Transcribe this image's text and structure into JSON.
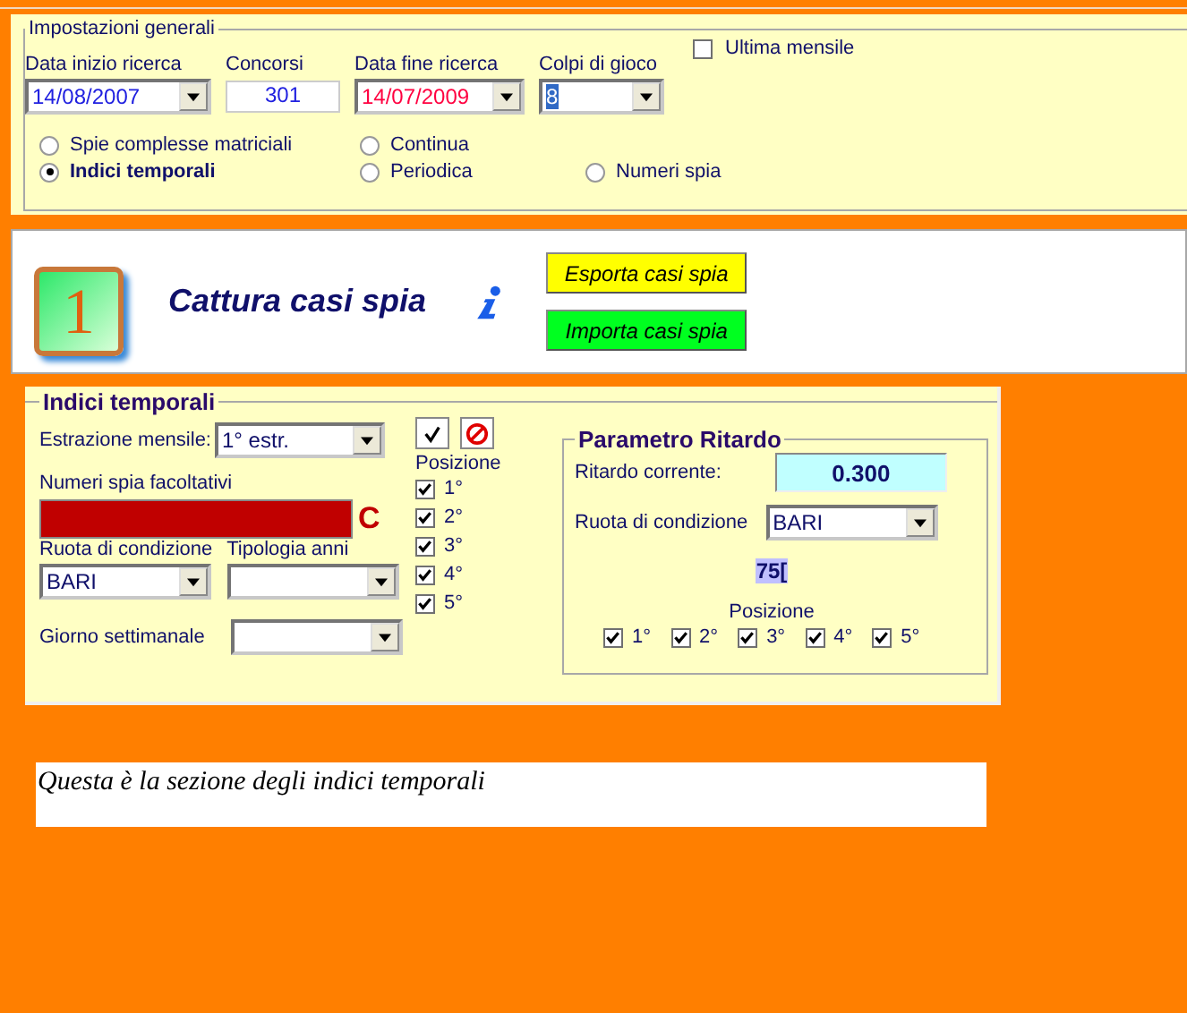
{
  "general": {
    "title": "Impostazioni generali",
    "fields": [
      {
        "label": "Data inizio ricerca",
        "value": "14/08/2007",
        "kind": "combo",
        "color": "#2020e0",
        "text_selected": false
      },
      {
        "label": "Concorsi",
        "value": "301",
        "kind": "text",
        "color": "#2020e0",
        "text_selected": false
      },
      {
        "label": "Data fine ricerca",
        "value": "14/07/2009",
        "kind": "combo",
        "color": "#ff0040",
        "text_selected": false
      },
      {
        "label": "Colpi di gioco",
        "value": "8",
        "kind": "combo",
        "text_selected": true
      }
    ],
    "ultima_mensile": {
      "label": "Ultima mensile",
      "checked": false
    },
    "radio_rows": [
      [
        {
          "label": "Spie complesse matriciali",
          "selected": false
        },
        {
          "label": "Continua",
          "selected": false
        }
      ],
      [
        {
          "label": "Indici temporali",
          "selected": true
        },
        {
          "label": "Periodica",
          "selected": false
        },
        {
          "label": "Numeri spia",
          "selected": false
        }
      ]
    ]
  },
  "header": {
    "badge": "1",
    "title": "Cattura casi spia",
    "buttons": [
      {
        "label": "Esporta casi spia",
        "color": "#ffff00"
      },
      {
        "label": "Importa casi spia",
        "color": "#00ff20"
      }
    ]
  },
  "indici": {
    "title": "Indici temporali",
    "estrazione": {
      "label": "Estrazione mensile:",
      "value": "1° estr."
    },
    "numeri_spia": {
      "label": "Numeri spia facoltativi",
      "marker": "C"
    },
    "ruota": {
      "label": "Ruota di condizione",
      "value": "BARI"
    },
    "tipologia": {
      "label": "Tipologia anni"
    },
    "giorno": {
      "label": "Giorno settimanale"
    },
    "posizione": {
      "label": "Posizione",
      "items": [
        {
          "label": "1°",
          "checked": true
        },
        {
          "label": "2°",
          "checked": true
        },
        {
          "label": "3°",
          "checked": true
        },
        {
          "label": "4°",
          "checked": true
        },
        {
          "label": "5°",
          "checked": true
        }
      ]
    },
    "parametro": {
      "title": "Parametro Ritardo",
      "ritardo": {
        "label": "Ritardo corrente:",
        "value": "0.300"
      },
      "ruota": {
        "label": "Ruota di condizione",
        "value": "BARI"
      },
      "code": "75[",
      "posizione": {
        "label": "Posizione",
        "items": [
          {
            "label": "1°",
            "checked": true
          },
          {
            "label": "2°",
            "checked": true
          },
          {
            "label": "3°",
            "checked": true
          },
          {
            "label": "4°",
            "checked": true
          },
          {
            "label": "5°",
            "checked": true
          }
        ]
      }
    }
  },
  "note": "Questa è la sezione degli indici temporali"
}
